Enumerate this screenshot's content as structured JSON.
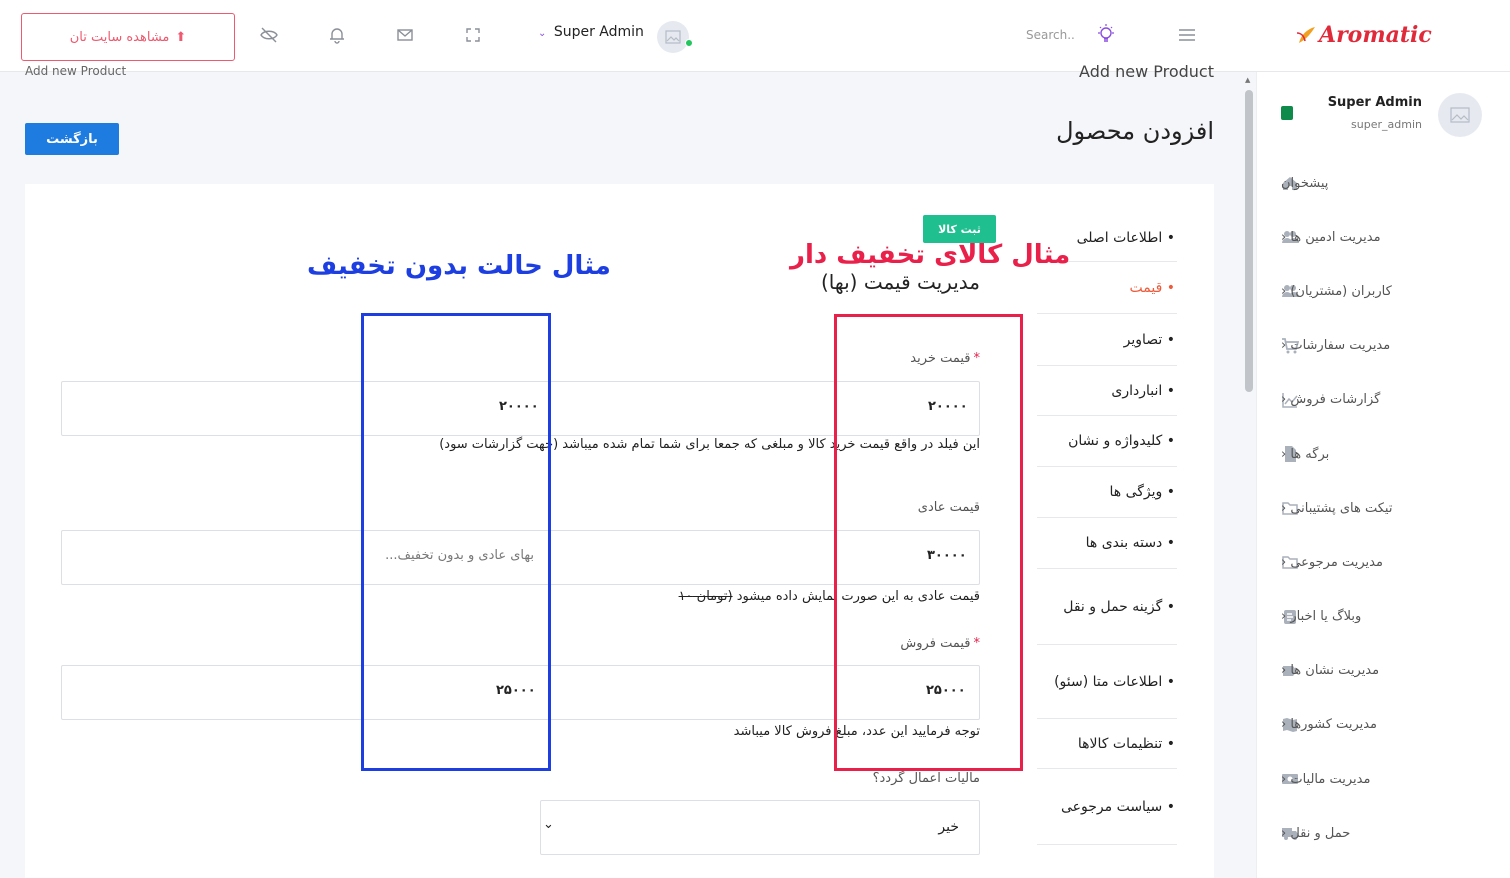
{
  "header": {
    "view_site_label": "مشاهده سایت تان",
    "admin_name": "Super Admin",
    "search_placeholder": "Search..",
    "brand": "Aromatic"
  },
  "sidebar": {
    "user_name": "Super Admin",
    "user_handle": "super_admin",
    "items": [
      {
        "label": "پیشخوان",
        "icon": "home-icon"
      },
      {
        "label": "مدیریت ادمین ها ‹",
        "icon": "users-icon"
      },
      {
        "label": "کاربران (مشتریان) ‹",
        "icon": "users-icon"
      },
      {
        "label": "مدیریت سفارشات ‹",
        "icon": "cart-icon"
      },
      {
        "label": "گزارشات فروش ‹",
        "icon": "chart-icon"
      },
      {
        "label": "برگه ها ‹",
        "icon": "file-icon"
      },
      {
        "label": "تیکت های پشتیبانی ‹",
        "icon": "folder-icon"
      },
      {
        "label": "مدیریت مرجوعی ‹",
        "icon": "folder-icon"
      },
      {
        "label": "وبلاگ یا اخبار ‹",
        "icon": "blog-icon"
      },
      {
        "label": "مدیریت نشان ها ‹",
        "icon": "tag-icon"
      },
      {
        "label": "مدیریت کشورها ‹",
        "icon": "map-icon"
      },
      {
        "label": "مدیریت مالیات ‹",
        "icon": "money-icon"
      },
      {
        "label": "حمل و نقل ‹",
        "icon": "truck-icon"
      }
    ]
  },
  "page": {
    "breadcrumb_right": "Add new Product",
    "breadcrumb_left": "Add new Product",
    "title": "افزودن محصول",
    "back_label": "بازگشت"
  },
  "tabs": [
    {
      "label": "• اطلاعات اصلی"
    },
    {
      "label": "• قیمت"
    },
    {
      "label": "• تصاویر"
    },
    {
      "label": "• انبارداری"
    },
    {
      "label": "• کلیدواژه و نشان"
    },
    {
      "label": "• ویژگی ها"
    },
    {
      "label": "• دسته بندی ها"
    },
    {
      "label": "• گزینه حمل و نقل"
    },
    {
      "label": "• اطلاعات متا (سئو)"
    },
    {
      "label": "• تنظیمات کالاها"
    },
    {
      "label": "• سیاست مرجوعی"
    }
  ],
  "form": {
    "submit_label": "ثبت کالا",
    "section_title": "مدیریت قیمت (بها)",
    "purchase_label": "قیمت خرید",
    "purchase_value_left": "۲۰۰۰۰",
    "purchase_value_right": "۲۰۰۰۰",
    "purchase_help": "این فیلد در واقع قیمت خرید کالا و مبلغی که جمعا برای شما تمام شده میباشد (جهت گزارشات سود)",
    "regular_label": "قیمت عادی",
    "regular_placeholder": "بهای عادی و بدون تخفیف...",
    "regular_value_right": "۳۰۰۰۰",
    "regular_help_prefix": "قیمت عادی به این صورت نمایش داده میشود",
    "regular_help_strike": "(تومان ۱۰",
    "sale_label": "قیمت فروش",
    "sale_value_left": "۲۵۰۰۰",
    "sale_value_right": "۲۵۰۰۰",
    "sale_help": "توجه فرمایید این عدد، مبلغ فروش کالا میباشد",
    "tax_label": "مالیات اعمال گردد؟",
    "tax_value": "خیر"
  },
  "annotations": {
    "with_discount": "مثال کالای تخفیف دار",
    "without_discount": "مثال حالت بدون تخفیف",
    "with_discount_color": "#e8204a",
    "without_discount_color": "#1d3ee0"
  },
  "colors": {
    "accent": "#1e7be0",
    "active_tab": "#f05a3a",
    "success": "#1fbf8f",
    "brand": "#e02a3a"
  }
}
